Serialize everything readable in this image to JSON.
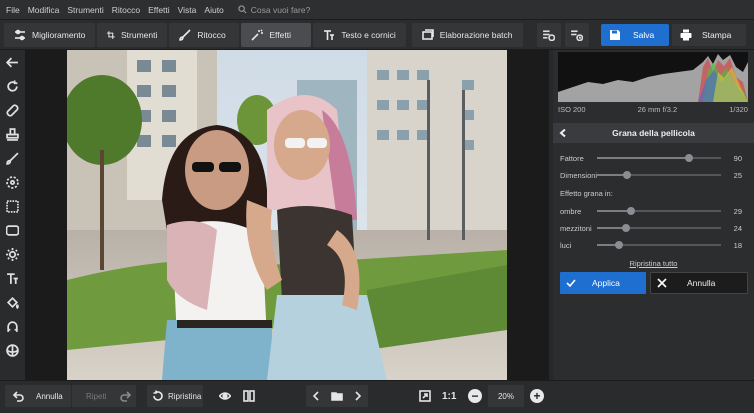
{
  "menu": {
    "items": [
      "File",
      "Modifica",
      "Strumenti",
      "Ritocco",
      "Effetti",
      "Vista",
      "Aiuto"
    ],
    "search_placeholder": "Cosa vuoi fare?"
  },
  "toolbar": {
    "tabs": [
      {
        "label": "Miglioramento",
        "icon": "sliders-icon"
      },
      {
        "label": "Strumenti",
        "icon": "crop-icon"
      },
      {
        "label": "Ritocco",
        "icon": "brush-icon"
      },
      {
        "label": "Effetti",
        "icon": "sparkle-icon",
        "active": true
      },
      {
        "label": "Testo e cornici",
        "icon": "text-icon"
      },
      {
        "label": "Elaborazione batch",
        "icon": "images-icon"
      }
    ],
    "save_label": "Salva",
    "print_label": "Stampa"
  },
  "histogram": {
    "iso": "ISO 200",
    "lens": "26 mm f/3.2",
    "shutter": "1/320"
  },
  "panel": {
    "title": "Grana della pellicola",
    "fattore": {
      "label": "Fattore",
      "value": 90
    },
    "dimensioni": {
      "label": "Dimensioni",
      "value": 25
    },
    "section_label": "Effetto grana in:",
    "ombre": {
      "label": "ombre",
      "value": 29
    },
    "mezzitoni": {
      "label": "mezzitoni",
      "value": 24
    },
    "luci": {
      "label": "luci",
      "value": 18
    },
    "reset_label": "Ripristina tutto",
    "apply_label": "Applica",
    "cancel_label": "Annulla"
  },
  "bottom": {
    "undo_label": "Annulla",
    "redo_label": "Ripeti",
    "restore_label": "Ripristina",
    "ratio_label": "1:1",
    "zoom_value": "20%"
  },
  "colors": {
    "accent": "#1f6fd1"
  }
}
